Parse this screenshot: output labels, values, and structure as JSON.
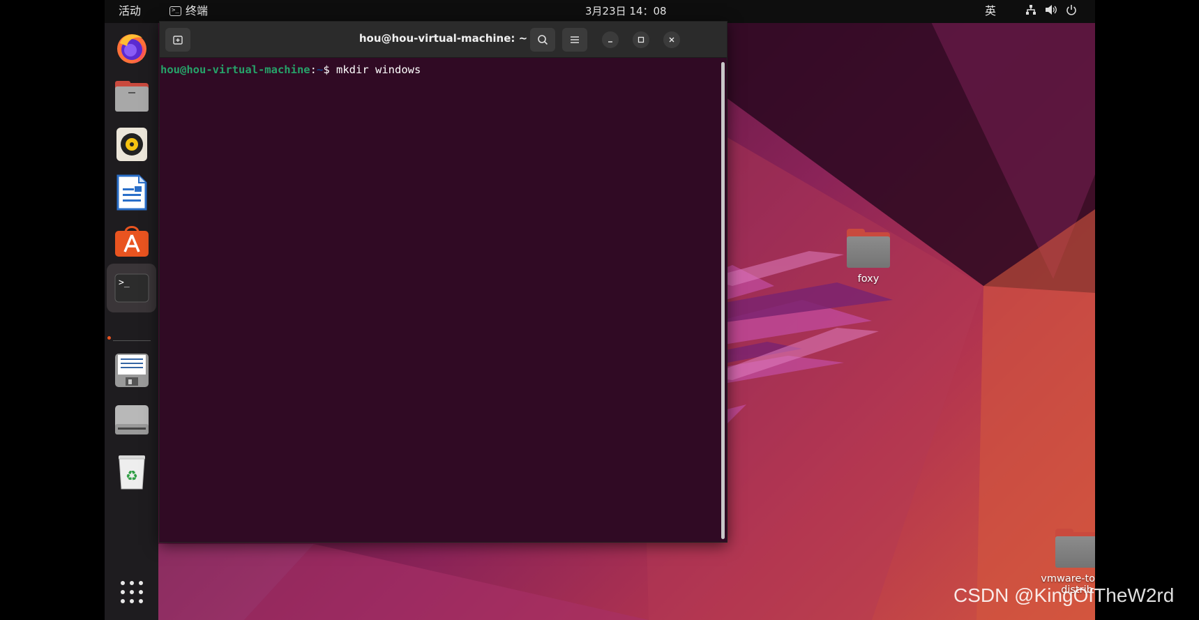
{
  "topbar": {
    "activities": "活动",
    "app_name": "终端",
    "app_icon": "terminal-icon",
    "clock": "3月23日  14：08",
    "input_method": "英",
    "tray_icons": [
      "network-icon",
      "volume-icon",
      "power-icon"
    ]
  },
  "dock": {
    "items": [
      {
        "name": "firefox",
        "icon": "firefox-icon"
      },
      {
        "name": "files",
        "icon": "files-icon"
      },
      {
        "name": "rhythmbox",
        "icon": "rhythmbox-icon"
      },
      {
        "name": "libreoffice-writer",
        "icon": "writer-icon"
      },
      {
        "name": "ubuntu-software",
        "icon": "software-icon"
      },
      {
        "name": "terminal",
        "icon": "terminal-icon",
        "active": true
      },
      {
        "name": "text-editor",
        "icon": "text-editor-icon"
      },
      {
        "name": "drive",
        "icon": "drive-icon"
      },
      {
        "name": "trash",
        "icon": "trash-icon"
      }
    ],
    "show_apps_icon": "grid-icon"
  },
  "terminal": {
    "title": "hou@hou-virtual-machine: ~",
    "prompt_user": "hou@hou-virtual-machine",
    "prompt_sep": ":",
    "prompt_path": "~",
    "prompt_symbol": "$ ",
    "command": "mkdir windows",
    "colors": {
      "background": "#300a24",
      "user": "#26a269",
      "path": "#12488b"
    }
  },
  "desktop": {
    "icons": [
      {
        "label": "foxy"
      },
      {
        "label_line1": "vmware-tools-",
        "label_line2": "distrib"
      }
    ]
  },
  "watermark": "CSDN @KingOfTheW2rd"
}
